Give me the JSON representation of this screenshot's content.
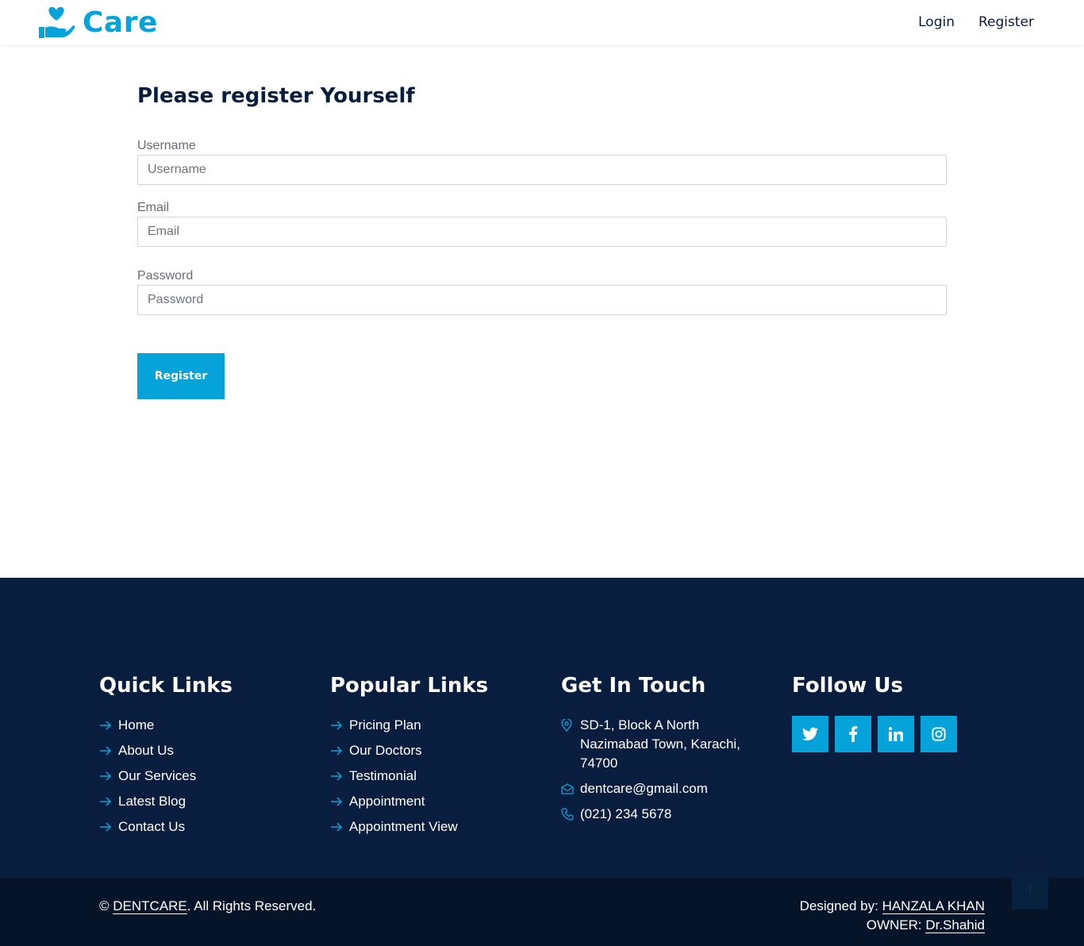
{
  "brand": {
    "name": "Care",
    "color": "#06a3da"
  },
  "nav": {
    "login": "Login",
    "register": "Register"
  },
  "form": {
    "title": "Please register Yourself",
    "username": {
      "label": "Username",
      "placeholder": "Username",
      "value": ""
    },
    "email": {
      "label": "Email",
      "placeholder": "Email",
      "value": ""
    },
    "password": {
      "label": "Password",
      "placeholder": "Password",
      "value": ""
    },
    "submit_label": "Register"
  },
  "footer": {
    "quick_links": {
      "heading": "Quick Links",
      "items": [
        "Home",
        "About Us",
        "Our Services",
        "Latest Blog",
        "Contact Us"
      ]
    },
    "popular_links": {
      "heading": "Popular Links",
      "items": [
        "Pricing Plan",
        "Our Doctors",
        "Testimonial",
        "Appointment",
        "Appointment View"
      ]
    },
    "contact": {
      "heading": "Get In Touch",
      "address": "SD-1, Block A North Nazimabad Town, Karachi, 74700",
      "email": "dentcare@gmail.com",
      "phone": "(021) 234 5678",
      "icons": [
        "map-pin-icon",
        "envelope-icon",
        "phone-icon"
      ]
    },
    "follow": {
      "heading": "Follow Us",
      "icons": [
        "twitter-icon",
        "facebook-icon",
        "linkedin-icon",
        "instagram-icon"
      ]
    }
  },
  "bottom": {
    "copyright_symbol": "©",
    "copyright_brand": "DENTCARE",
    "copyright_suffix": ". All Rights Reserved.",
    "designed_prefix": "Designed by: ",
    "designer": "HANZALA KHAN",
    "owner_prefix": "OWNER: ",
    "owner": "Dr.Shahid"
  },
  "colors": {
    "primary": "#06a3da",
    "dark": "#091e3e",
    "darker": "#061429"
  }
}
